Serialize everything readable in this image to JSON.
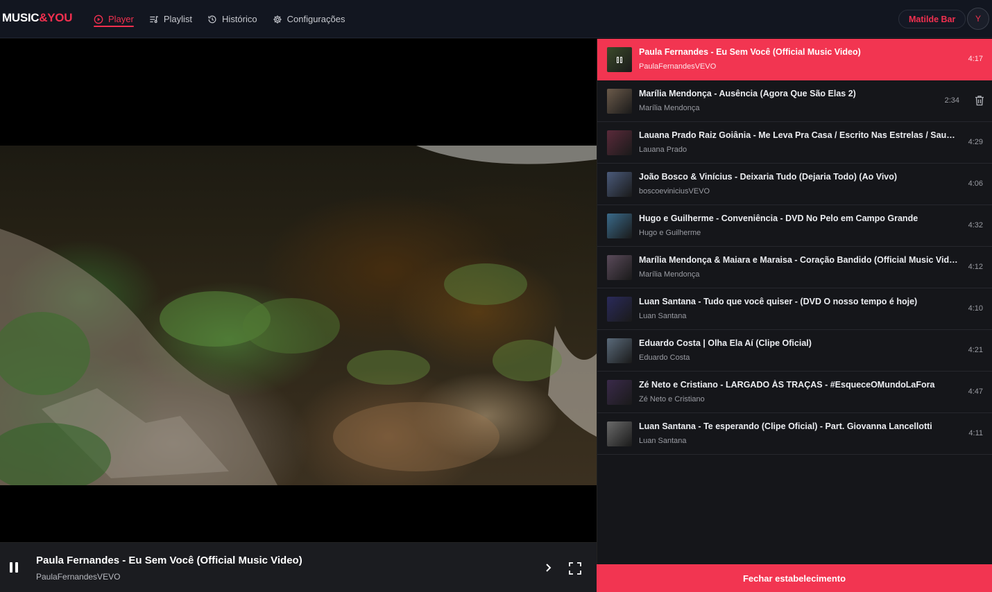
{
  "app": {
    "logo_main": "MUSIC",
    "logo_accent": "&YOU",
    "accent_color": "#f2304f"
  },
  "nav": {
    "items": [
      {
        "label": "Player",
        "icon": "play-circle-icon",
        "active": true
      },
      {
        "label": "Playlist",
        "icon": "playlist-icon",
        "active": false
      },
      {
        "label": "Histórico",
        "icon": "history-icon",
        "active": false
      },
      {
        "label": "Configurações",
        "icon": "gear-icon",
        "active": false
      }
    ]
  },
  "user": {
    "name": "Matilde Bar",
    "avatar_letter": "Y"
  },
  "now_playing": {
    "title": "Paula Fernandes - Eu Sem Você (Official Music Video)",
    "channel": "PaulaFernandesVEVO",
    "state": "playing"
  },
  "playlist": [
    {
      "title": "Paula Fernandes - Eu Sem Você (Official Music Video)",
      "channel": "PaulaFernandesVEVO",
      "duration": "4:17",
      "active": true,
      "thumb_color": "#3b4a2a"
    },
    {
      "title": "Marília Mendonça - Ausência (Agora Que São Elas 2)",
      "channel": "Marília Mendonça",
      "duration": "2:34",
      "active": false,
      "has_delete": true,
      "thumb_color": "#6b5a4a"
    },
    {
      "title": "Lauana Prado Raiz Goiânia - Me Leva Pra Casa / Escrito Nas Estrelas / Saudade Sem Fim",
      "channel": "Lauana Prado",
      "duration": "4:29",
      "active": false,
      "thumb_color": "#5a2a3a"
    },
    {
      "title": "João Bosco & Vinícius - Deixaria Tudo (Dejaria Todo) (Ao Vivo)",
      "channel": "boscoeviniciusVEVO",
      "duration": "4:06",
      "active": false,
      "thumb_color": "#4a5a7a"
    },
    {
      "title": "Hugo e Guilherme - Conveniência - DVD No Pelo em Campo Grande",
      "channel": "Hugo e Guilherme",
      "duration": "4:32",
      "active": false,
      "thumb_color": "#3a6a8a"
    },
    {
      "title": "Marília Mendonça & Maiara e Maraisa - Coração Bandido (Official Music Video)",
      "channel": "Marília Mendonça",
      "duration": "4:12",
      "active": false,
      "thumb_color": "#5a4a5a"
    },
    {
      "title": "Luan Santana - Tudo que você quiser - (DVD O nosso tempo é hoje)",
      "channel": "Luan Santana",
      "duration": "4:10",
      "active": false,
      "thumb_color": "#2a2a5a"
    },
    {
      "title": "Eduardo Costa | Olha Ela Aí (Clipe Oficial)",
      "channel": "Eduardo Costa",
      "duration": "4:21",
      "active": false,
      "thumb_color": "#5a6a7a"
    },
    {
      "title": "Zé Neto e Cristiano - LARGADO ÀS TRAÇAS - #EsqueceOMundoLaFora",
      "channel": "Zé Neto e Cristiano",
      "duration": "4:47",
      "active": false,
      "thumb_color": "#3a2a4a"
    },
    {
      "title": "Luan Santana - Te esperando (Clipe Oficial) - Part. Giovanna Lancellotti",
      "channel": "Luan Santana",
      "duration": "4:11",
      "active": false,
      "thumb_color": "#6a6a6a"
    }
  ],
  "footer": {
    "close_label": "Fechar estabelecimento"
  }
}
